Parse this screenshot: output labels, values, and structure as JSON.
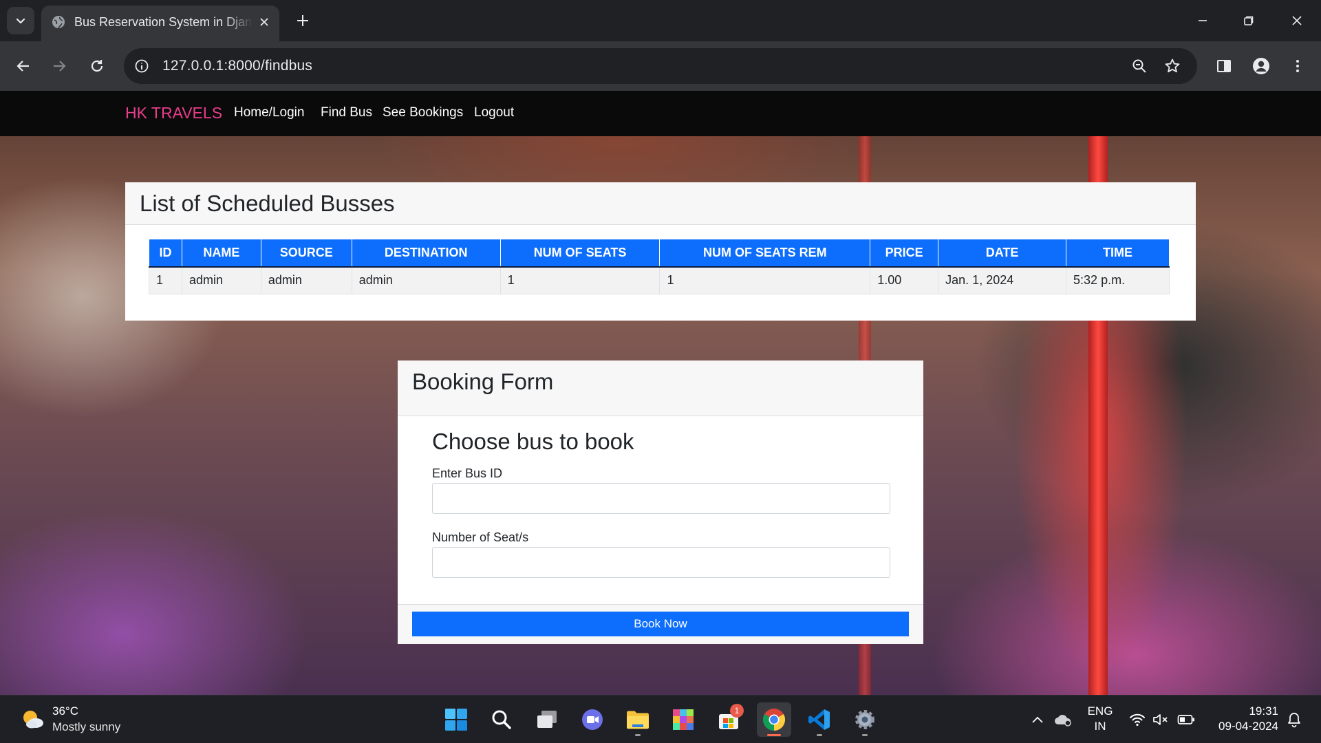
{
  "browser": {
    "tab_title": "Bus Reservation System in Django",
    "url": "127.0.0.1:8000/findbus"
  },
  "navbar": {
    "brand": "HK TRAVELS",
    "links": [
      "Home/Login",
      "Find Bus",
      "See Bookings",
      "Logout"
    ]
  },
  "schedule": {
    "title": "List of Scheduled Busses",
    "columns": [
      "ID",
      "NAME",
      "SOURCE",
      "DESTINATION",
      "NUM OF SEATS",
      "NUM OF SEATS REM",
      "PRICE",
      "DATE",
      "TIME"
    ],
    "rows": [
      [
        "1",
        "admin",
        "admin",
        "admin",
        "1",
        "1",
        "1.00",
        "Jan. 1, 2024",
        "5:32 p.m."
      ]
    ]
  },
  "booking": {
    "title": "Booking Form",
    "heading": "Choose bus to book",
    "bus_id_label": "Enter Bus ID",
    "bus_id_value": "",
    "seats_label": "Number of Seat/s",
    "seats_value": "",
    "submit_label": "Book Now"
  },
  "taskbar": {
    "weather_temp": "36°C",
    "weather_desc": "Mostly sunny",
    "store_badge": "1",
    "lang_line1": "ENG",
    "lang_line2": "IN",
    "time": "19:31",
    "date": "09-04-2024"
  },
  "colors": {
    "brand": "#e83e8c",
    "primary": "#0d6efd",
    "navbar": "#0a0a0a"
  }
}
